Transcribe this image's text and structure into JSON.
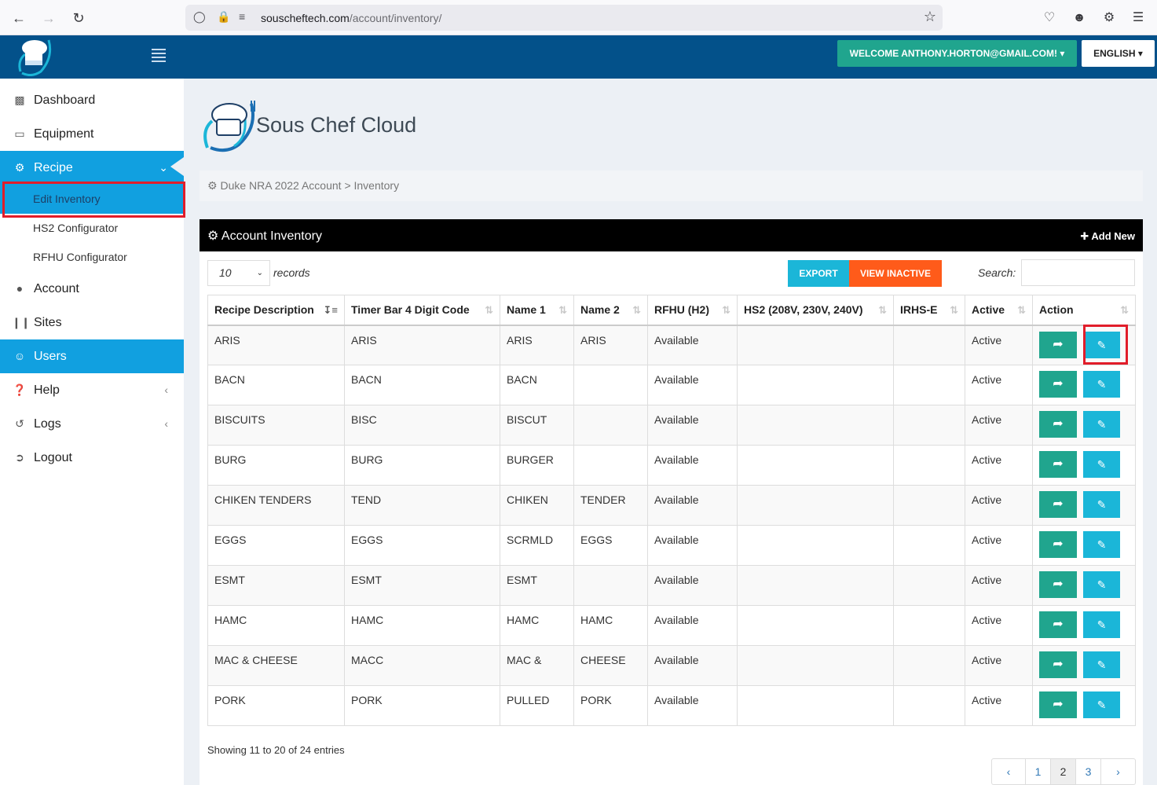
{
  "browser": {
    "url_domain": "souscheftech.com",
    "url_path": "/account/inventory/"
  },
  "header": {
    "welcome": "WELCOME ANTHONY.HORTON@GMAIL.COM!",
    "language": "ENGLISH"
  },
  "sidebar": {
    "dashboard": "Dashboard",
    "equipment": "Equipment",
    "recipe": "Recipe",
    "edit_inventory": "Edit Inventory",
    "hs2": "HS2 Configurator",
    "rfhu": "RFHU Configurator",
    "account": "Account",
    "sites": "Sites",
    "users": "Users",
    "help": "Help",
    "logs": "Logs",
    "logout": "Logout"
  },
  "brand": {
    "title": "Sous Chef Cloud"
  },
  "breadcrumb": "Duke NRA 2022 Account > Inventory",
  "panel": {
    "title": "Account Inventory",
    "add_new": "Add New",
    "length_value": "10",
    "length_label": "records",
    "export": "EXPORT",
    "view_inactive": "VIEW INACTIVE",
    "search_label": "Search:",
    "search_value": ""
  },
  "table": {
    "columns": [
      "Recipe Description",
      "Timer Bar 4 Digit Code",
      "Name 1",
      "Name 2",
      "RFHU (H2)",
      "HS2 (208V, 230V, 240V)",
      "IRHS-E",
      "Active",
      "Action"
    ],
    "rows": [
      [
        "ARIS",
        "ARIS",
        "ARIS",
        "ARIS",
        "Available",
        "",
        "",
        "Active"
      ],
      [
        "BACN",
        "BACN",
        "BACN",
        "",
        "Available",
        "",
        "",
        "Active"
      ],
      [
        "BISCUITS",
        "BISC",
        "BISCUT",
        "",
        "Available",
        "",
        "",
        "Active"
      ],
      [
        "BURG",
        "BURG",
        "BURGER",
        "",
        "Available",
        "",
        "",
        "Active"
      ],
      [
        "CHIKEN TENDERS",
        "TEND",
        "CHIKEN",
        "TENDER",
        "Available",
        "",
        "",
        "Active"
      ],
      [
        "EGGS",
        "EGGS",
        "SCRMLD",
        "EGGS",
        "Available",
        "",
        "",
        "Active"
      ],
      [
        "ESMT",
        "ESMT",
        "ESMT",
        "",
        "Available",
        "",
        "",
        "Active"
      ],
      [
        "HAMC",
        "HAMC",
        "HAMC",
        "HAMC",
        "Available",
        "",
        "",
        "Active"
      ],
      [
        "MAC & CHEESE",
        "MACC",
        "MAC &",
        "CHEESE",
        "Available",
        "",
        "",
        "Active"
      ],
      [
        "PORK",
        "PORK",
        "PULLED",
        "PORK",
        "Available",
        "",
        "",
        "Active"
      ]
    ]
  },
  "footer": {
    "info": "Showing 11 to 20 of 24 entries",
    "pages": [
      "1",
      "2",
      "3"
    ],
    "current_page": "2"
  },
  "colors": {
    "header": "#03518a",
    "active": "#11a0e0",
    "teal": "#20a58e",
    "cyan": "#1bb6d8",
    "orange": "#ff5b1a",
    "highlight": "#e11d2a"
  }
}
